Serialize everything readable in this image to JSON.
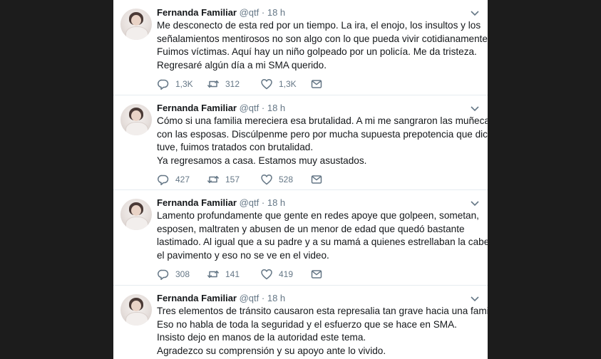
{
  "tweets": [
    {
      "name": "Fernanda Familiar",
      "handle": "@qtf",
      "dot": "·",
      "time": "18 h",
      "lines": [
        "Me desconecto de esta red por un tiempo. La ira, el enojo, los insultos y los",
        "señalamientos mentirosos no son algo con lo que pueda vivir cotidianamente.",
        "Fuimos víctimas. Aquí hay un niño golpeado por un policía. Me da tristeza.",
        "Regresaré algún día a mi SMA querido."
      ],
      "replies": "1,3K",
      "retweets": "312",
      "likes": "1,3K"
    },
    {
      "name": "Fernanda Familiar",
      "handle": "@qtf",
      "dot": "·",
      "time": "18 h",
      "lines": [
        "Cómo si una familia mereciera esa brutalidad. A mi me sangraron las muñecas",
        "con las esposas. Discúlpenme pero por mucha supuesta prepotencia que dicen",
        "tuve, fuimos tratados con brutalidad.",
        "Ya regresamos a casa. Estamos muy asustados."
      ],
      "replies": "427",
      "retweets": "157",
      "likes": "528"
    },
    {
      "name": "Fernanda Familiar",
      "handle": "@qtf",
      "dot": "·",
      "time": "18 h",
      "lines": [
        "Lamento profundamente que gente en redes apoye que golpeen, sometan,",
        "esposen, maltraten y abusen de un menor de edad que quedó bastante",
        "lastimado. Al igual que a su padre y a su mamá a quienes estrellaban la cabeza en",
        "el pavimento y eso no se ve en el video."
      ],
      "replies": "308",
      "retweets": "141",
      "likes": "419"
    },
    {
      "name": "Fernanda Familiar",
      "handle": "@qtf",
      "dot": "·",
      "time": "18 h",
      "lines": [
        "Tres elementos de tránsito causaron esta represalia tan grave hacia una familia.",
        "Eso no habla de toda la seguridad y el esfuerzo que se hace en SMA.",
        "Insisto dejo en manos de la autoridad este tema.",
        "Agradezco su comprensión y su apoyo ante lo vivido."
      ]
    }
  ],
  "colors": {
    "background": "#1c1c1c",
    "card": "#ffffff",
    "text": "#14171a",
    "muted": "#657786",
    "divider": "#e6ecf0"
  },
  "icons": [
    "reply-icon",
    "retweet-icon",
    "like-icon",
    "direct-message-icon",
    "chevron-down-icon"
  ]
}
